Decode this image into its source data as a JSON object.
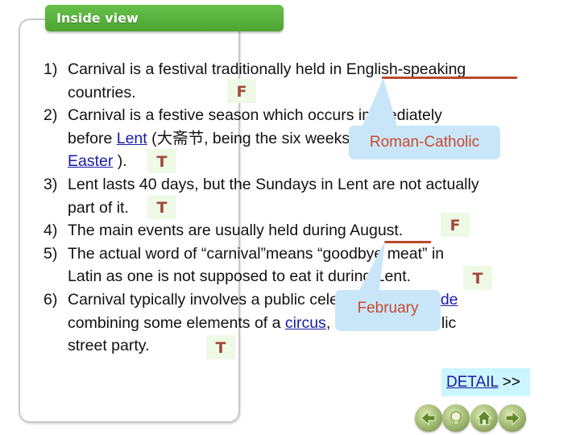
{
  "header": {
    "title": "Inside view"
  },
  "items": [
    {
      "num": "1)",
      "text_a": "Carnival is a festival traditionally held in ",
      "highlight": "English-speaking",
      "text_b": "countries.",
      "answer": "F"
    },
    {
      "num": "2)",
      "text_a": "Carnival is a festive season which occurs immediately",
      "text_b1": "before ",
      "link1": "Lent",
      "text_b2": " (大斋节, being the six weeks before the",
      "link2": "Easter",
      "text_c": " ).",
      "answer": "T"
    },
    {
      "num": "3)",
      "text_a": "Lent lasts 40 days, but the Sundays in Lent are not actually",
      "text_b": "part of it.",
      "answer": "T"
    },
    {
      "num": "4)",
      "text_a": "The main events are usually held during ",
      "highlight": "August",
      "text_b": ".",
      "answer": "F"
    },
    {
      "num": "5)",
      "text_a": "The actual word of “carnival”means “goodbye meat” in",
      "text_b": "Latin as one is not supposed to eat it during Lent.",
      "answer": "T"
    },
    {
      "num": "6)",
      "text_a": "Carnival typically involves a public celebration or ",
      "link1": "parade",
      "text_b1": "combining some elements of a ",
      "link2": "circus",
      "text_b2": ", masks and public",
      "text_c": "street party.",
      "answer": "T"
    }
  ],
  "callouts": {
    "correction_1": "Roman-Catholic",
    "correction_4": "February"
  },
  "detail": {
    "link": "DETAIL",
    "suffix": " >>"
  },
  "nav": {
    "back": "back-arrow",
    "hint": "lightbulb",
    "home": "home",
    "forward": "forward-arrow"
  }
}
